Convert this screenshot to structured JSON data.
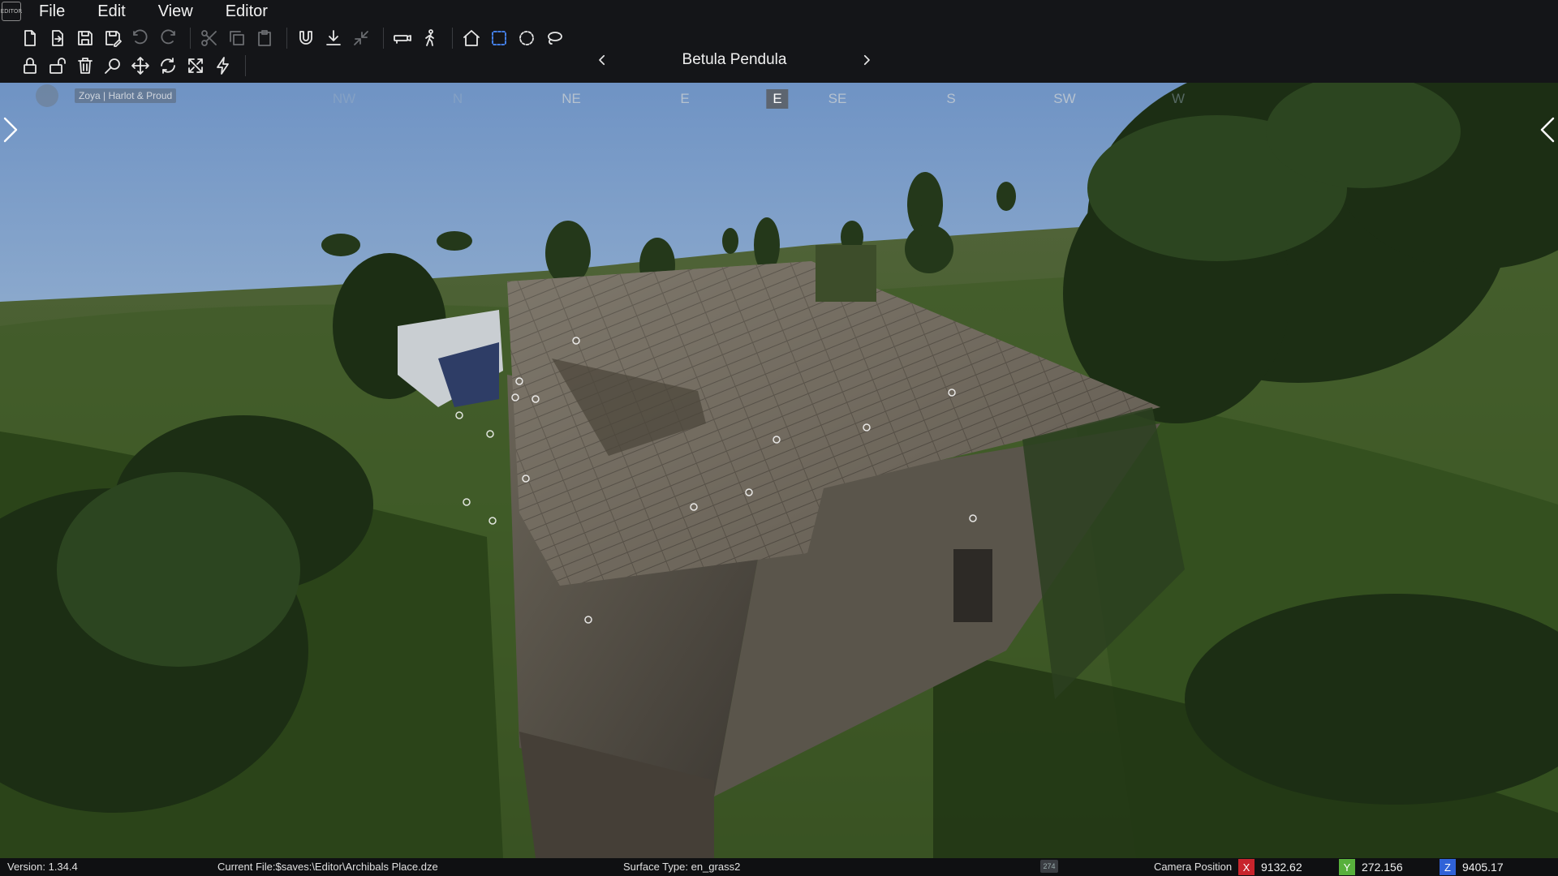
{
  "app": {
    "logo_label": "EDITOR"
  },
  "menubar": {
    "items": [
      {
        "label": "File"
      },
      {
        "label": "Edit"
      },
      {
        "label": "View"
      },
      {
        "label": "Editor"
      }
    ]
  },
  "toolbar": {
    "brush_name": "Betula Pendula",
    "icons_row1": [
      "new-file-icon",
      "open-file-icon",
      "save-icon",
      "save-as-icon",
      "undo-icon",
      "redo-icon",
      "cut-icon",
      "copy-icon",
      "paste-icon",
      "magnet-icon",
      "ground-snap-icon",
      "collapse-icon",
      "camera-tool-icon",
      "walk-icon",
      "home-icon",
      "box-select-icon",
      "circle-select-icon",
      "lasso-select-icon"
    ],
    "icons_row2": [
      "lock-icon",
      "unlock-icon",
      "trash-icon",
      "zoom-icon",
      "move-icon",
      "rotate-icon",
      "scale-icon",
      "lightning-icon"
    ]
  },
  "compass": {
    "labels": [
      {
        "text": "NW",
        "state": "faded"
      },
      {
        "text": "N",
        "state": "faded"
      },
      {
        "text": "NE",
        "state": "normal"
      },
      {
        "text": "E",
        "state": "normal"
      },
      {
        "text": "E",
        "state": "active"
      },
      {
        "text": "SE",
        "state": "normal"
      },
      {
        "text": "S",
        "state": "normal"
      },
      {
        "text": "SW",
        "state": "normal"
      },
      {
        "text": "W",
        "state": "faded"
      }
    ]
  },
  "user": {
    "label": "Zoya | Harlot & Proud"
  },
  "statusbar": {
    "version": "Version:  1.34.4",
    "current_file": "Current File:$saves:\\Editor\\Archibals Place.dze",
    "surface_type": "Surface Type: en_grass2",
    "icon_text": "274",
    "camera_position_label": "Camera Position",
    "x_axis": "X",
    "x_value": "9132.62",
    "y_axis": "Y",
    "y_value": "272.156",
    "z_axis": "Z",
    "z_value": "9405.17"
  }
}
